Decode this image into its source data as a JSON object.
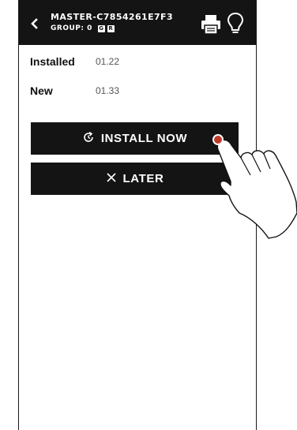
{
  "header": {
    "back_icon": "chevron-left-icon",
    "title": "MASTER-C7854261E7F3",
    "group_label": "GROUP: 0",
    "badges": [
      "G",
      "R"
    ],
    "print_icon": "printer-icon",
    "light_icon": "lightbulb-icon"
  },
  "firmware": {
    "installed_label": "Installed",
    "installed_value": "01.22",
    "new_label": "New",
    "new_value": "01.33"
  },
  "actions": {
    "install_icon": "restart-icon",
    "install_label": "INSTALL NOW",
    "later_icon": "close-icon",
    "later_label": "LATER"
  },
  "colors": {
    "header_bg": "#141414",
    "button_bg": "#141414",
    "tap_indicator": "#c0392b"
  }
}
